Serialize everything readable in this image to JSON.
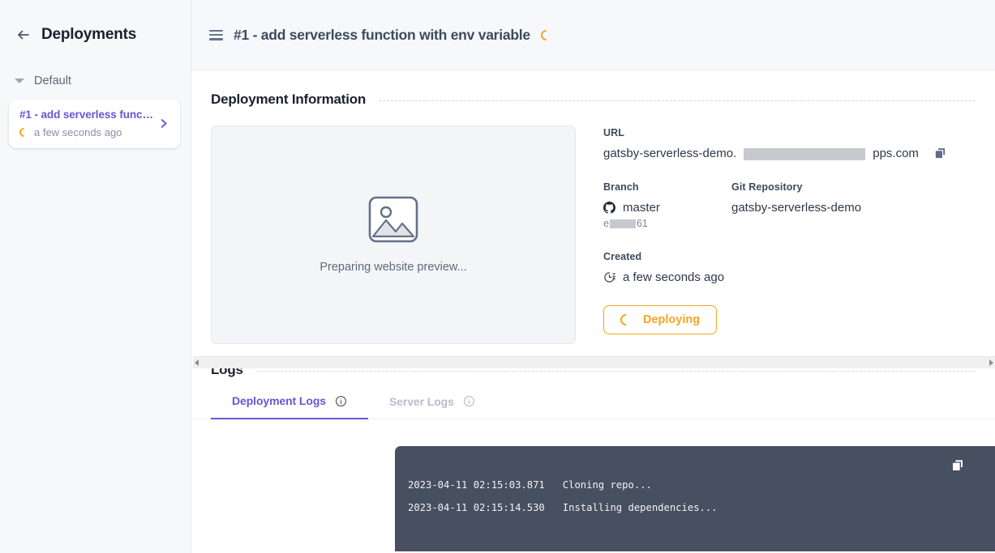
{
  "sidebar": {
    "back_icon": "back-arrow-icon",
    "title": "Deployments",
    "group_label": "Default",
    "caret_icon": "caret-down-icon",
    "items": [
      {
        "title": "#1 - add serverless funct...",
        "status_icon": "spinner-icon",
        "timestamp": "a few seconds ago",
        "chevron_icon": "chevron-right-icon"
      }
    ]
  },
  "topbar": {
    "menu_icon": "hamburger-menu-icon",
    "title": "#1 - add serverless function with env variable",
    "status_icon": "spinner-icon"
  },
  "deployment_information": {
    "heading": "Deployment Information",
    "preview": {
      "placeholder_icon": "image-placeholder-icon",
      "text": "Preparing website preview..."
    },
    "url": {
      "label": "URL",
      "prefix": "gatsby-serverless-demo.",
      "redacted": "",
      "suffix": "pps.com",
      "copy_icon": "copy-icon"
    },
    "branch": {
      "label": "Branch",
      "icon": "github-icon",
      "value": "master",
      "commit_prefix": "e",
      "commit_suffix": "61"
    },
    "git_repository": {
      "label": "Git Repository",
      "value": "gatsby-serverless-demo"
    },
    "created": {
      "label": "Created",
      "icon": "clock-history-icon",
      "value": "a few seconds ago"
    },
    "status_button": {
      "icon": "spinner-icon",
      "label": "Deploying"
    }
  },
  "scrollbar": {
    "left_arrow_icon": "scroll-left-arrow-icon",
    "right_arrow_icon": "scroll-right-arrow-icon"
  },
  "logs": {
    "heading": "Logs",
    "tabs": [
      {
        "label": "Deployment Logs",
        "info_icon": "info-icon",
        "active": true
      },
      {
        "label": "Server Logs",
        "info_icon": "info-icon",
        "active": false
      }
    ],
    "console": {
      "copy_icon": "copy-icon",
      "lines": [
        "2023-04-11 02:15:03.871   Cloning repo...",
        "2023-04-11 02:15:14.530   Installing dependencies..."
      ]
    }
  },
  "colors": {
    "accent_purple": "#6558d3",
    "accent_orange": "#f5a623",
    "console_bg": "#475060",
    "sidebar_bg": "#f7f8fa",
    "topbar_bg": "#f7f8fb"
  }
}
